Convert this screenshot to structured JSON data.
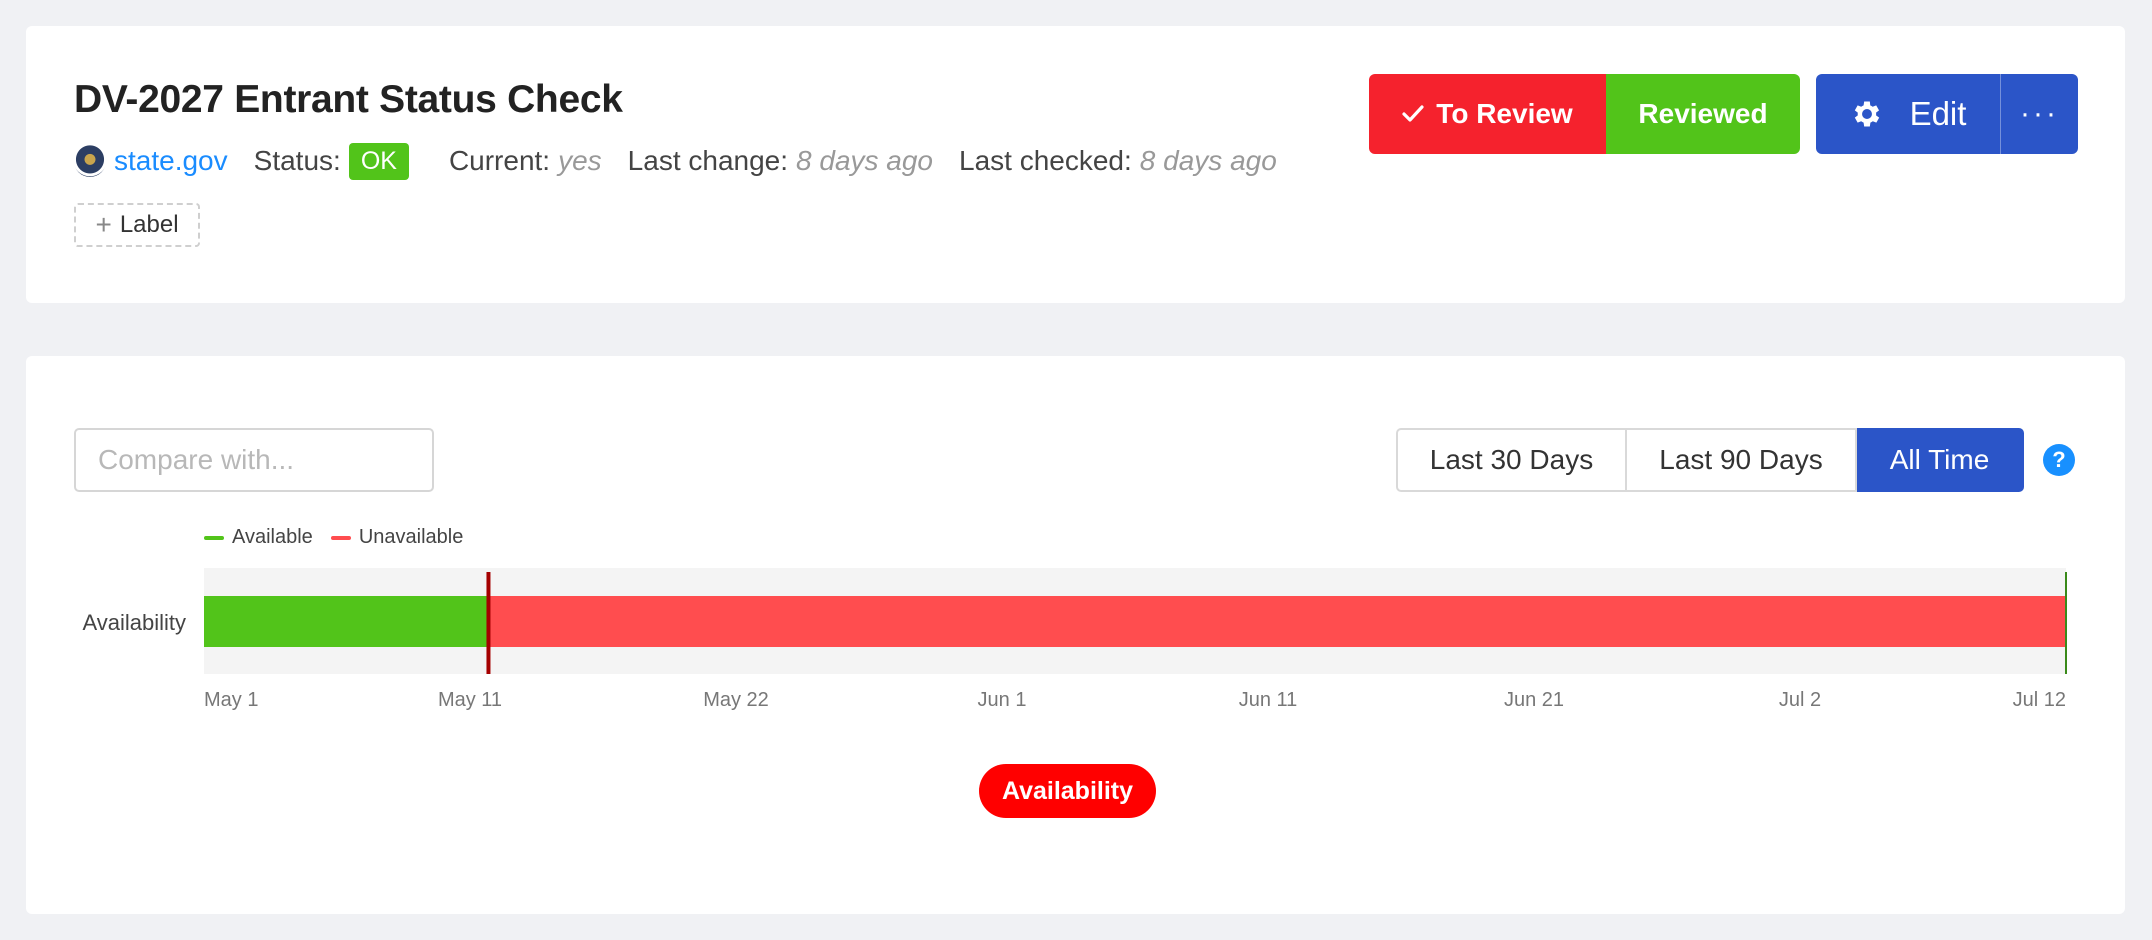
{
  "header": {
    "title": "DV-2027 Entrant Status Check",
    "site": "state.gov",
    "status_label": "Status:",
    "status_value": "OK",
    "current_label": "Current:",
    "current_value": "yes",
    "last_change_label": "Last change:",
    "last_change_value": "8 days ago",
    "last_checked_label": "Last checked:",
    "last_checked_value": "8 days ago",
    "add_label": "Label"
  },
  "actions": {
    "to_review": "To Review",
    "reviewed": "Reviewed",
    "edit": "Edit",
    "more": "···"
  },
  "controls": {
    "compare_placeholder": "Compare with...",
    "ranges": [
      "Last 30 Days",
      "Last 90 Days",
      "All Time"
    ],
    "active_range": "All Time",
    "help": "?"
  },
  "colors": {
    "available": "#52c41a",
    "unavailable": "#ff4d4f",
    "primary": "#2b55c8",
    "danger": "#f5222d"
  },
  "chart_data": {
    "type": "bar",
    "ylabel": "Availability",
    "categories": [
      "Availability"
    ],
    "legend": [
      {
        "name": "Available",
        "color": "#52c41a"
      },
      {
        "name": "Unavailable",
        "color": "#ff4d4f"
      }
    ],
    "x_ticks": [
      "May 1",
      "May 11",
      "May 22",
      "Jun 1",
      "Jun 11",
      "Jun 21",
      "Jul 2",
      "Jul 12"
    ],
    "x_range": [
      "May 1",
      "Jul 12"
    ],
    "segments": [
      {
        "series": "Available",
        "start": "May 1",
        "end": "May 12"
      },
      {
        "series": "Unavailable",
        "start": "May 12",
        "end": "Jul 12"
      }
    ],
    "markers": [
      "May 12",
      "Jul 12"
    ],
    "toggle_label": "Availability"
  }
}
